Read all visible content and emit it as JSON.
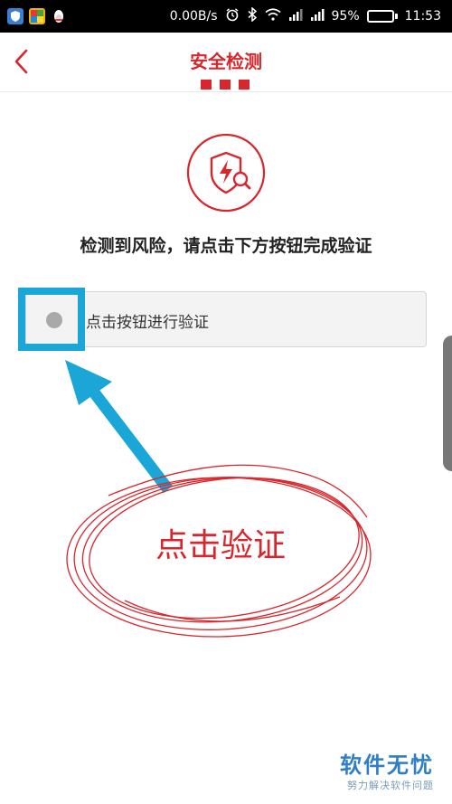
{
  "status_bar": {
    "speed": "0.00B/s",
    "battery": "95%",
    "battery_fraction": 0.95,
    "time": "11:53"
  },
  "header": {
    "title": "安全检测",
    "step_dots": 3
  },
  "main": {
    "prompt": "检测到风险，请点击下方按钮完成验证",
    "verify_button_label": "点击按钮进行验证"
  },
  "annotation": {
    "label": "点击验证",
    "highlight_color": "#1aa6d6",
    "circle_color": "#d9262c"
  },
  "watermark": {
    "name": "软件无忧",
    "subtitle": "努力解决软件问题"
  },
  "colors": {
    "accent": "#d9262c",
    "watermark": "#2f7fc8"
  },
  "icons": [
    "back-chevron-icon",
    "shield-lightning-search-icon",
    "alarm-icon",
    "bluetooth-icon",
    "wifi-icon",
    "signal-icon",
    "battery-icon"
  ]
}
